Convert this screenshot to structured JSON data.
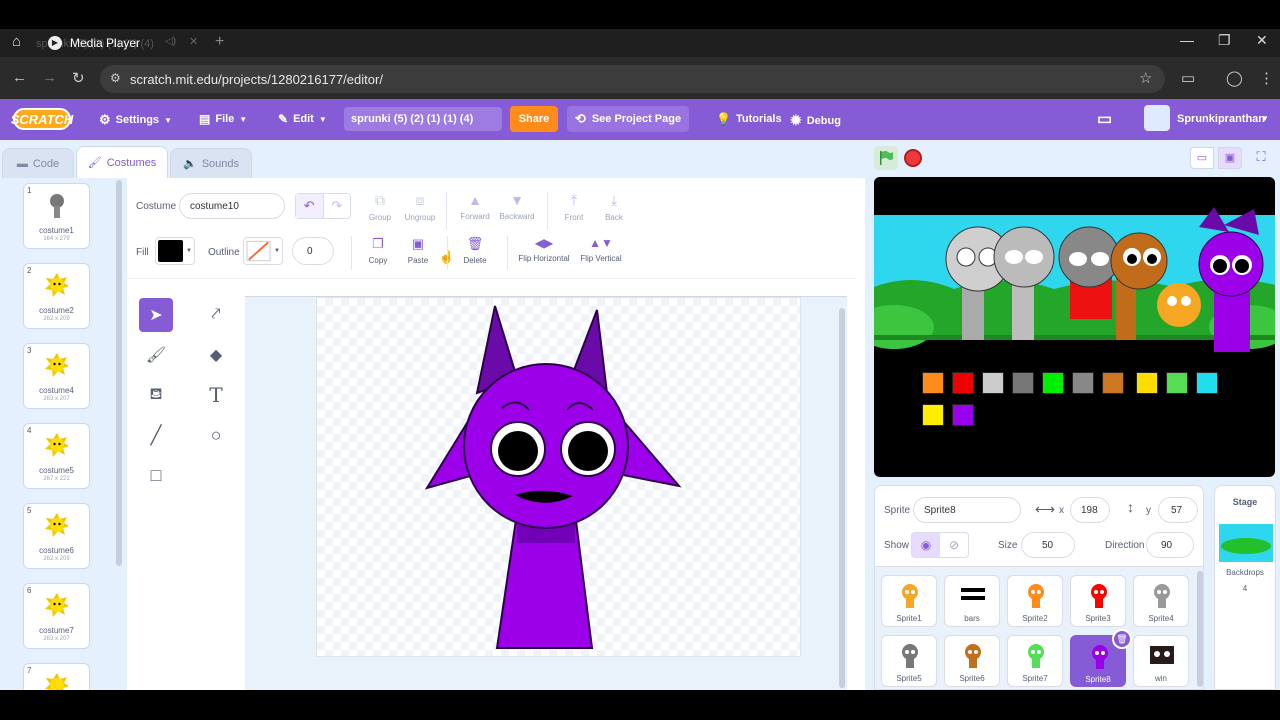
{
  "browser": {
    "tab_title": "Media Player",
    "tab_ghost": "sprunki (5) (2) (1) (1) (4)",
    "url": "scratch.mit.edu/projects/1280216177/editor/"
  },
  "menubar": {
    "logo": "SCRATCH",
    "settings": "Settings",
    "file": "File",
    "edit": "Edit",
    "project_title": "sprunki (5) (2) (1) (1) (4)",
    "share": "Share",
    "see_project": "See Project Page",
    "tutorials": "Tutorials",
    "debug": "Debug",
    "username": "Sprunkipranthan"
  },
  "tabs": {
    "code": "Code",
    "costumes": "Costumes",
    "sounds": "Sounds"
  },
  "costumes": [
    {
      "num": "1",
      "name": "costume1",
      "dim": "164 x 279"
    },
    {
      "num": "2",
      "name": "costume2",
      "dim": "262 x 209"
    },
    {
      "num": "3",
      "name": "costume4",
      "dim": "263 x 207"
    },
    {
      "num": "4",
      "name": "costume5",
      "dim": "267 x 221"
    },
    {
      "num": "5",
      "name": "costume6",
      "dim": "262 x 209"
    },
    {
      "num": "6",
      "name": "costume7",
      "dim": "263 x 207"
    },
    {
      "num": "7",
      "name": "",
      "dim": ""
    }
  ],
  "editor": {
    "costume_label": "Costume",
    "costume_name": "costume10",
    "fill_label": "Fill",
    "outline_label": "Outline",
    "outline_width": "0",
    "group": "Group",
    "ungroup": "Ungroup",
    "forward": "Forward",
    "backward": "Backward",
    "front": "Front",
    "back": "Back",
    "copy": "Copy",
    "paste": "Paste",
    "delete": "Delete",
    "flip_h": "Flip Horizontal",
    "flip_v": "Flip Vertical"
  },
  "sprite_info": {
    "sprite_label": "Sprite",
    "sprite_name": "Sprite8",
    "x_label": "x",
    "x": "198",
    "y_label": "y",
    "y": "57",
    "show_label": "Show",
    "size_label": "Size",
    "size": "50",
    "direction_label": "Direction",
    "direction": "90"
  },
  "sprites": [
    {
      "name": "Sprite1",
      "color": "#f5a623"
    },
    {
      "name": "bars",
      "color": "#000000"
    },
    {
      "name": "Sprite2",
      "color": "#ff8c1a"
    },
    {
      "name": "Sprite3",
      "color": "#ff0000"
    },
    {
      "name": "Sprite4",
      "color": "#9a9a9a"
    },
    {
      "name": "Sprite5",
      "color": "#777777"
    },
    {
      "name": "Sprite6",
      "color": "#c0701c"
    },
    {
      "name": "Sprite7",
      "color": "#55dd55"
    },
    {
      "name": "Sprite8",
      "color": "#9b00e8"
    },
    {
      "name": "win",
      "color": "#2a1a1a"
    }
  ],
  "stage_pane": {
    "title": "Stage",
    "backdrops_label": "Backdrops",
    "backdrops_count": "4"
  },
  "stage_icons": [
    "#ff8c1a",
    "#ee0000",
    "#cccccc",
    "#777777",
    "#00ee00",
    "#888888",
    "#cc7722",
    "#ffdd00",
    "#55dd55",
    "#22ddee",
    "#ffee00",
    "#9900ee"
  ],
  "colors": {
    "accent": "#855cd6",
    "share": "#ff8c1a",
    "character": "#9b00e8"
  }
}
